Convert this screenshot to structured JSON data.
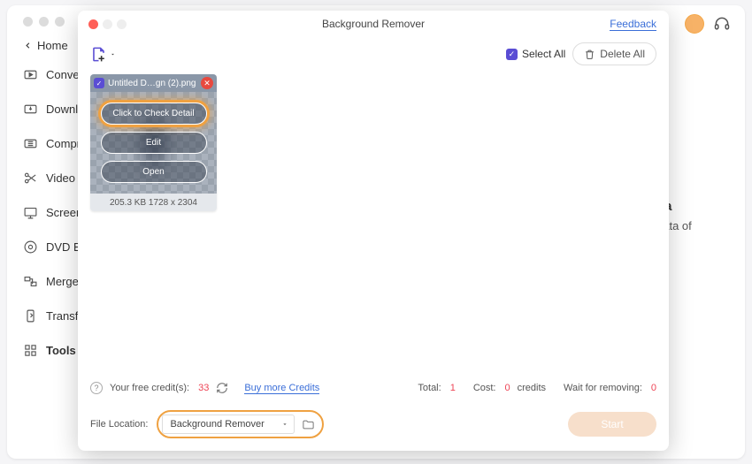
{
  "sidebar": {
    "home": "Home",
    "items": [
      "Conver",
      "Downlo",
      "Compr",
      "Video E",
      "Screen",
      "DVD Bu",
      "Merger",
      "Transfe",
      "Tools"
    ]
  },
  "bg_right": {
    "title1": "n",
    "title2": "ıta",
    "sub": "data of"
  },
  "modal": {
    "title": "Background Remover",
    "feedback": "Feedback",
    "select_all": "Select All",
    "delete_all": "Delete All"
  },
  "thumb": {
    "filename": "Untitled D…gn (2).png",
    "btn_detail": "Click to Check Detail",
    "btn_edit": "Edit",
    "btn_open": "Open",
    "meta": "205.3 KB 1728 x 2304"
  },
  "status": {
    "credits_label": "Your free credit(s):",
    "credits_value": "33",
    "buy_more": "Buy more Credits",
    "total_label": "Total:",
    "total_value": "1",
    "cost_label": "Cost:",
    "cost_value": "0",
    "cost_unit": "credits",
    "wait_label": "Wait for removing:",
    "wait_value": "0"
  },
  "footer": {
    "file_location_label": "File Location:",
    "location_value": "Background Remover",
    "start": "Start"
  }
}
